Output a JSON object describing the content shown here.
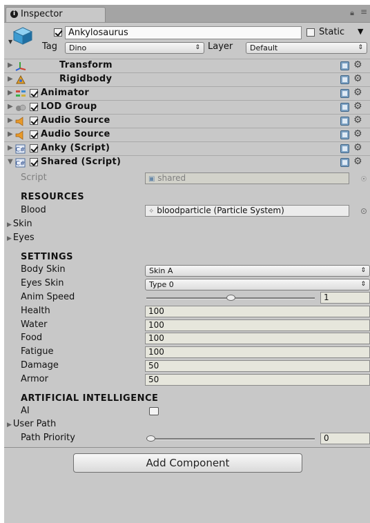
{
  "tab": {
    "label": "Inspector"
  },
  "object": {
    "name": "Ankylosaurus",
    "enabled": true,
    "static_label": "Static",
    "tag_label": "Tag",
    "tag_value": "Dino",
    "layer_label": "Layer",
    "layer_value": "Default"
  },
  "components": [
    {
      "name": "Transform",
      "checkbox": false,
      "expanded": false,
      "icon": "transform-icon"
    },
    {
      "name": "Rigidbody",
      "checkbox": false,
      "expanded": false,
      "icon": "rigidbody-icon"
    },
    {
      "name": "Animator",
      "checkbox": true,
      "expanded": false,
      "icon": "animator-icon"
    },
    {
      "name": "LOD Group",
      "checkbox": true,
      "expanded": false,
      "icon": "lod-group-icon"
    },
    {
      "name": "Audio Source",
      "checkbox": true,
      "expanded": false,
      "icon": "audio-source-icon"
    },
    {
      "name": "Audio Source",
      "checkbox": true,
      "expanded": false,
      "icon": "audio-source-icon"
    },
    {
      "name": "Anky (Script)",
      "checkbox": true,
      "expanded": false,
      "icon": "script-icon"
    },
    {
      "name": "Shared (Script)",
      "checkbox": true,
      "expanded": true,
      "icon": "script-icon"
    }
  ],
  "shared": {
    "script_label": "Script",
    "script_value": "shared",
    "resources_header": "RESOURCES",
    "blood_label": "Blood",
    "blood_value": "bloodparticle (Particle System)",
    "skin_label": "Skin",
    "eyes_label": "Eyes",
    "settings_header": "SETTINGS",
    "body_skin_label": "Body Skin",
    "body_skin_value": "Skin A",
    "eyes_skin_label": "Eyes Skin",
    "eyes_skin_value": "Type 0",
    "anim_speed_label": "Anim Speed",
    "anim_speed_value": "1",
    "anim_speed_fraction": 0.5,
    "health_label": "Health",
    "health_value": "100",
    "water_label": "Water",
    "water_value": "100",
    "food_label": "Food",
    "food_value": "100",
    "fatigue_label": "Fatigue",
    "fatigue_value": "100",
    "damage_label": "Damage",
    "damage_value": "50",
    "armor_label": "Armor",
    "armor_value": "50",
    "ai_header": "ARTIFICIAL INTELLIGENCE",
    "ai_label": "AI",
    "ai_enabled": false,
    "user_path_label": "User Path",
    "path_priority_label": "Path Priority",
    "path_priority_value": "0",
    "path_priority_fraction": 0
  },
  "add_component_label": "Add Component"
}
